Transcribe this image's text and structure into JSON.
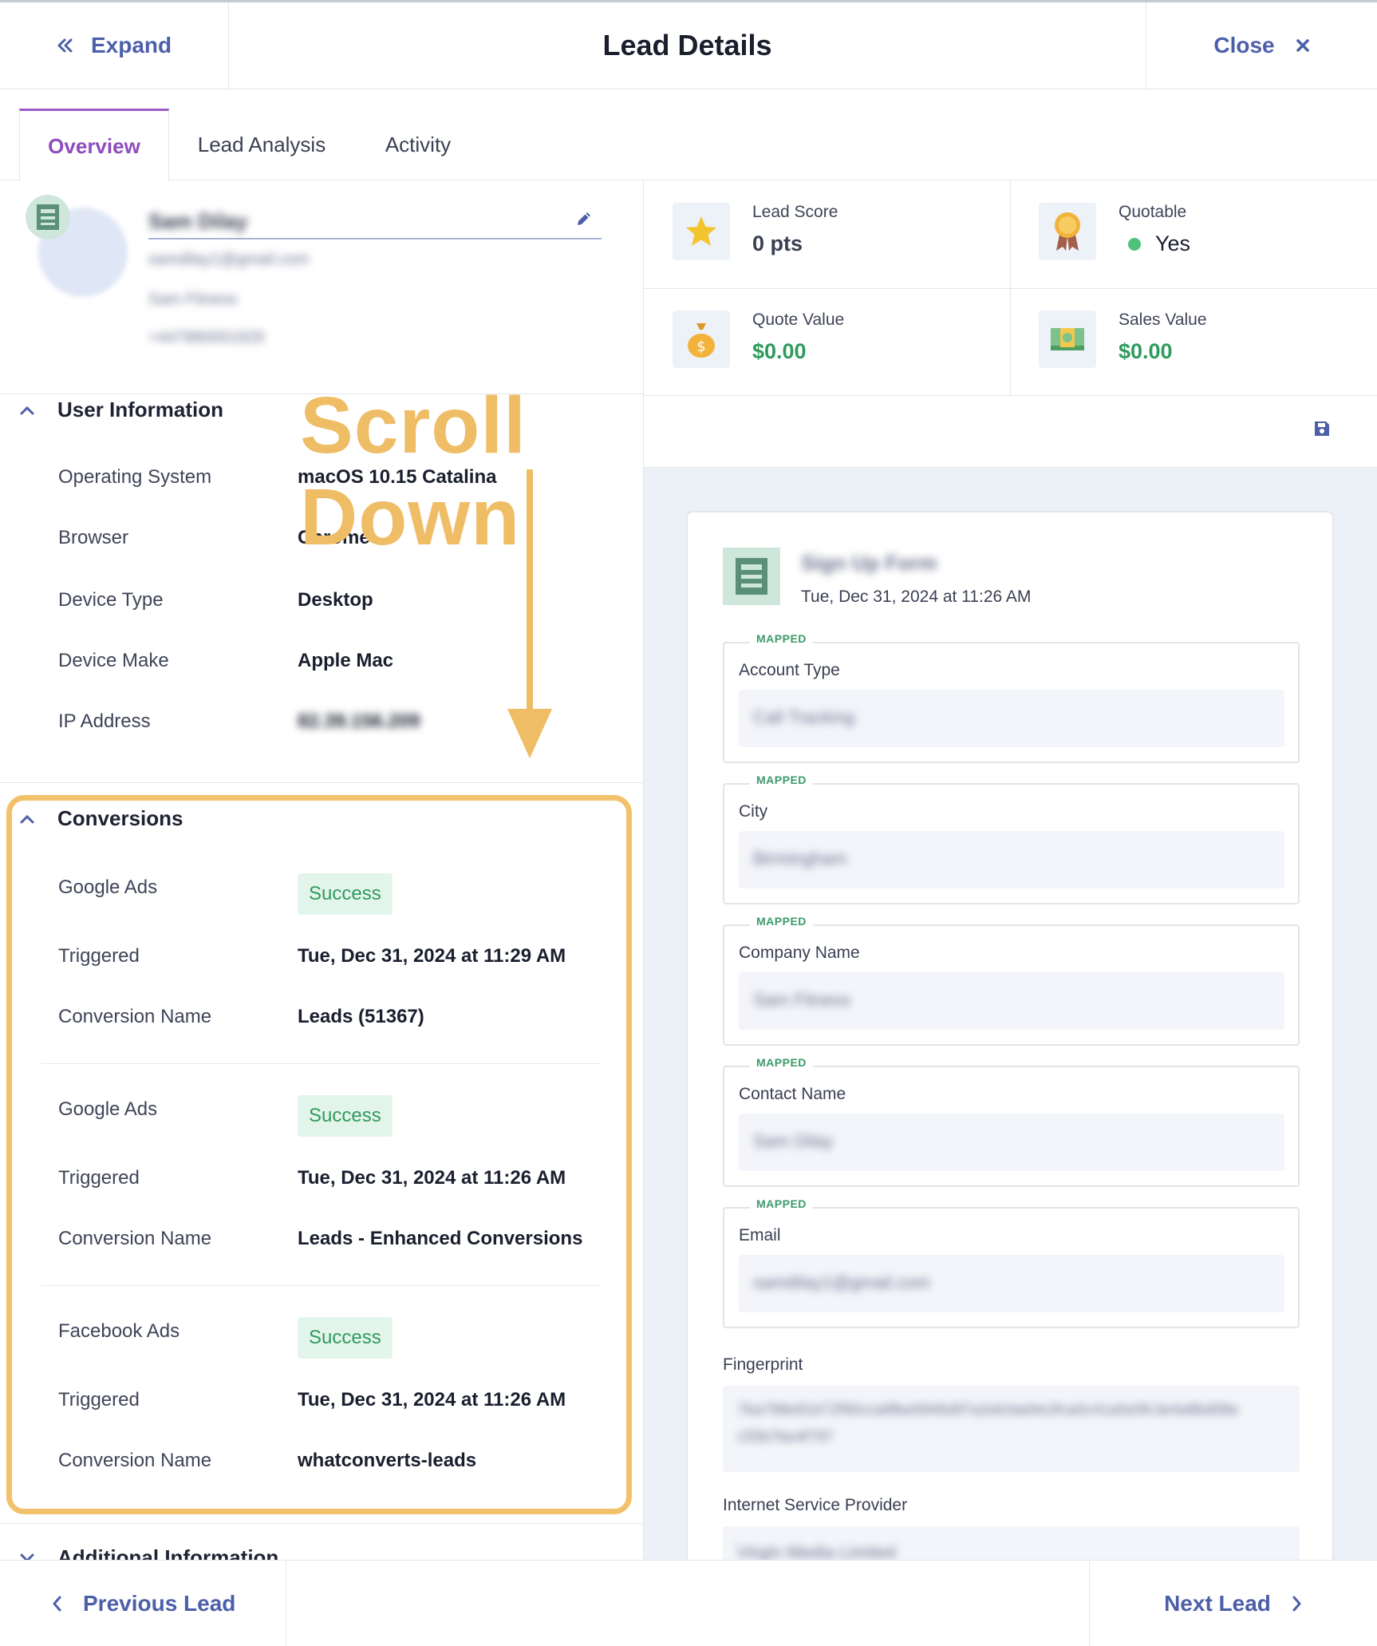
{
  "header": {
    "expand_label": "Expand",
    "title": "Lead Details",
    "close_label": "Close"
  },
  "tabs": [
    {
      "label": "Overview",
      "active": true
    },
    {
      "label": "Lead Analysis",
      "active": false
    },
    {
      "label": "Activity",
      "active": false
    }
  ],
  "profile": {
    "name": "Sam Dilay",
    "email": "samdilay1@gmail.com",
    "company": "Sam Fitness",
    "phone": "+447880001929"
  },
  "stats": {
    "lead_score": {
      "label": "Lead Score",
      "value": "0 pts"
    },
    "quotable": {
      "label": "Quotable",
      "value": "Yes"
    },
    "quote_value": {
      "label": "Quote Value",
      "value": "$0.00"
    },
    "sales_value": {
      "label": "Sales Value",
      "value": "$0.00"
    }
  },
  "user_info": {
    "heading": "User Information",
    "rows": [
      {
        "key": "Operating System",
        "value": "macOS 10.15 Catalina"
      },
      {
        "key": "Browser",
        "value": "Chrome"
      },
      {
        "key": "Device Type",
        "value": "Desktop"
      },
      {
        "key": "Device Make",
        "value": "Apple Mac"
      },
      {
        "key": "IP Address",
        "value": "82.39.156.209"
      }
    ]
  },
  "annotation": {
    "scroll_text": "Scroll Down"
  },
  "conversions": {
    "heading": "Conversions",
    "items": [
      {
        "platform": "Google Ads",
        "status": "Success",
        "triggered_label": "Triggered",
        "triggered": "Tue, Dec 31, 2024 at 11:29 AM",
        "name_label": "Conversion Name",
        "name": "Leads (51367)"
      },
      {
        "platform": "Google Ads",
        "status": "Success",
        "triggered_label": "Triggered",
        "triggered": "Tue, Dec 31, 2024 at 11:26 AM",
        "name_label": "Conversion Name",
        "name": "Leads - Enhanced Conversions"
      },
      {
        "platform": "Facebook Ads",
        "status": "Success",
        "triggered_label": "Triggered",
        "triggered": "Tue, Dec 31, 2024 at 11:26 AM",
        "name_label": "Conversion Name",
        "name": "whatconverts-leads"
      }
    ]
  },
  "additional": {
    "heading": "Additional Information"
  },
  "form": {
    "title": "Sign Up Form",
    "date": "Tue, Dec 31, 2024 at 11:26 AM",
    "mapped_tag": "MAPPED",
    "fields": [
      {
        "label": "Account Type",
        "value": "Call Tracking"
      },
      {
        "label": "City",
        "value": "Birmingham"
      },
      {
        "label": "Company Name",
        "value": "Sam Fitness"
      },
      {
        "label": "Contact Name",
        "value": "Sam Dilay"
      },
      {
        "label": "Email",
        "value": "samdilay1@gmail.com"
      }
    ],
    "fingerprint": {
      "label": "Fingerprint",
      "value": "7ba798e91b72f90cca9fbe0846d97a2eb3ad4e2fca0c41a5e0fc3e4a8bd08e",
      "value2": "c55b7be4f797"
    },
    "isp": {
      "label": "Internet Service Provider",
      "value": "Virgin Media Limited"
    }
  },
  "footer": {
    "previous_label": "Previous Lead",
    "next_label": "Next Lead"
  },
  "colors": {
    "accent": "#4c5fa9",
    "active_tab": "#8e4cbd",
    "success": "#2f9a5d",
    "highlight": "#f3c06b"
  }
}
